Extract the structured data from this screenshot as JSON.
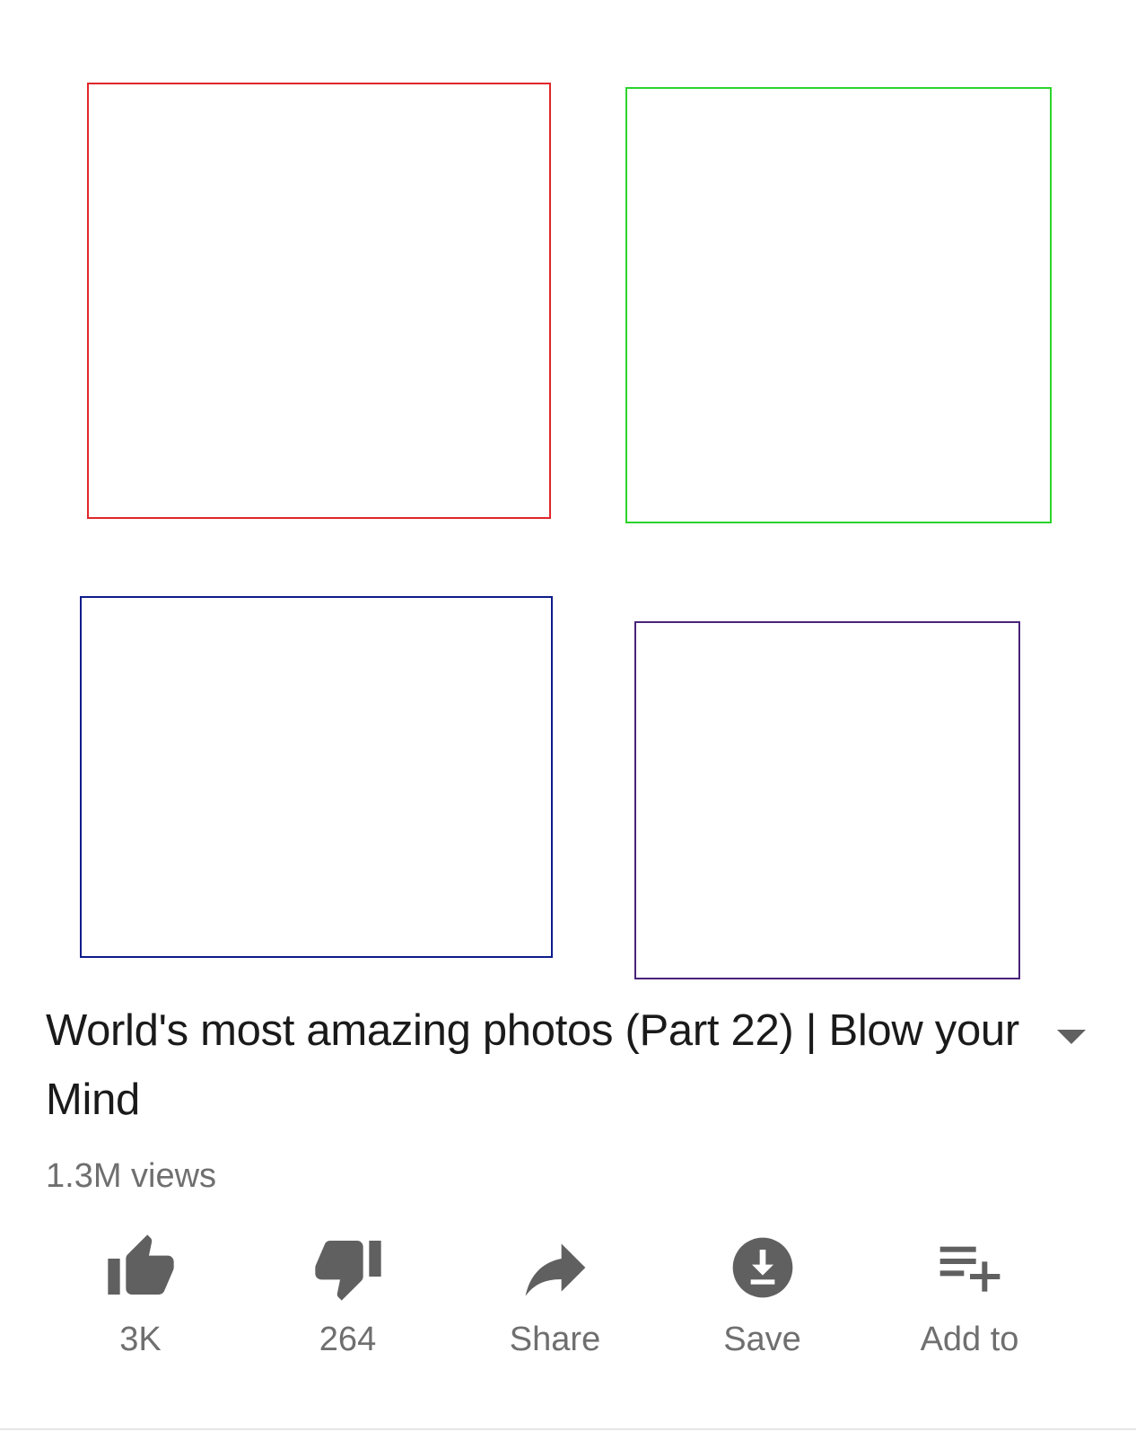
{
  "video": {
    "title": "World's most amazing photos (Part 22) | Blow your Mind",
    "views": "1.3M views",
    "frame_colors": [
      "#e0262a",
      "#2bd42b",
      "#0d1b8c",
      "#4a237a"
    ]
  },
  "actions": [
    {
      "icon": "thumbs-up-icon",
      "label": "3K"
    },
    {
      "icon": "thumbs-down-icon",
      "label": "264"
    },
    {
      "icon": "share-icon",
      "label": "Share"
    },
    {
      "icon": "download-icon",
      "label": "Save"
    },
    {
      "icon": "add-to-playlist-icon",
      "label": "Add to"
    }
  ],
  "colors": {
    "icon": "#606060",
    "title": "#1a1a1a",
    "secondary_text": "#6f6f6f"
  }
}
